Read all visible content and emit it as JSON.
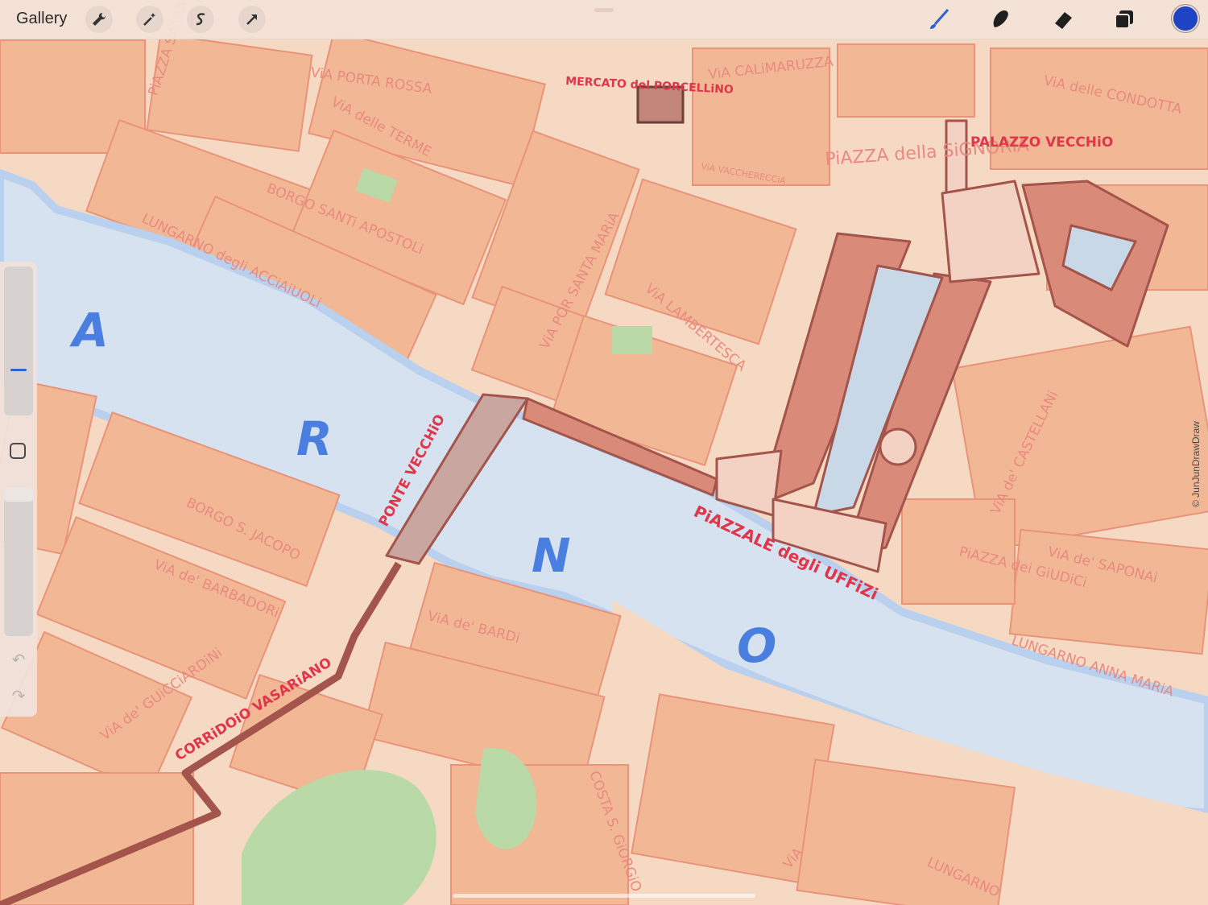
{
  "toolbar": {
    "gallery_label": "Gallery",
    "left_icons": [
      "wrench-icon",
      "magic-wand-icon",
      "selection-s-icon",
      "transform-arrow-icon"
    ],
    "right_icons": [
      "brush-icon",
      "smudge-icon",
      "eraser-icon",
      "layers-icon"
    ],
    "current_color": "#1e43c4"
  },
  "sidebar": {
    "brush_size_level": 0.3,
    "opacity_level": 0.0,
    "undo_icon": "undo-arrow-icon",
    "redo_icon": "redo-arrow-icon"
  },
  "map": {
    "river_letters": [
      "A",
      "R",
      "N",
      "O"
    ],
    "streets": [
      "ViA PORTA ROSSA",
      "ViA CALiMARUZZA",
      "ViA delle CONDOTTA",
      "ViA delle TERME",
      "BORGO SANTi APOSTOLi",
      "LUNGARNO degli ACCiAiUOLi",
      "PiAZZA SANTA TRiNiTA",
      "ViA POR SANTA MARiA",
      "ViA LAMBERTESCA",
      "ViA VACCHERECCiA",
      "BORGO S. JACOPO",
      "ViA de' BARBADORi",
      "ViA de' GUiCCiARDiNi",
      "ViA de' BARDi",
      "ViA de' CASTELLANi",
      "ViA de' SAPONAi",
      "LUNGARNO ANNA MARiA",
      "COSTA S. GiORGiO",
      "LUNGARNO",
      "ViA",
      "PiAZZA dei GiUDiCi"
    ],
    "landmarks": [
      "MERCATO del PORCELLiNO",
      "PiAZZA della SiGNORiA",
      "PALAZZO VECCHiO",
      "PONTE VECCHiO",
      "PiAZZALE degli UFFiZi",
      "CORRiDOiO VASARiANO"
    ],
    "colors": {
      "land": "#f6d9c2",
      "buildings": "#f2b896",
      "building_outline": "#e8937a",
      "river": "#d6e2ef",
      "river_edge": "#b9d0ee",
      "landmark_fill": "#d98a78",
      "landmark_outline": "#a3554c",
      "street_text": "#e98a80",
      "landmark_text": "#e0364a",
      "river_letters": "#4a7fe0",
      "garden": "#b9d9a6"
    }
  },
  "watermark": "© JunJunDrawDraw"
}
